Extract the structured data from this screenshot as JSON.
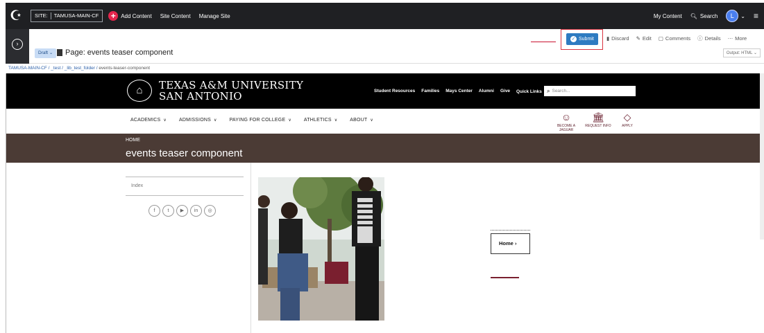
{
  "cms": {
    "site_label": "SITE:",
    "site_name": "TAMUSA-MAIN-CF",
    "add_content": "Add Content",
    "site_content": "Site Content",
    "manage_site": "Manage Site",
    "my_content": "My Content",
    "search": "Search",
    "user_initial": "L"
  },
  "toolbar": {
    "draft": "Draft",
    "page_title": "Page: events teaser component",
    "submit": "Submit",
    "discard": "Discard",
    "edit": "Edit",
    "comments": "Comments",
    "details": "Details",
    "more": "More",
    "output": "Output: HTML"
  },
  "breadcrumb": {
    "items": [
      "TAMUSA-MAIN-CF",
      "_test",
      "_lib_test_folder"
    ],
    "current": "events-teaser-component"
  },
  "site": {
    "uni_line1": "TEXAS A&M UNIVERSITY",
    "uni_line2": "SAN ANTONIO",
    "header_links": [
      "Student Resources",
      "Families",
      "Mays Center",
      "Alumni",
      "Give",
      "Quick Links"
    ],
    "search_placeholder": "Search...",
    "nav": [
      "ACADEMICS",
      "ADMISSIONS",
      "PAYING FOR COLLEGE",
      "ATHLETICS",
      "ABOUT"
    ],
    "cta": [
      "BECOME A JAGUAR",
      "REQUEST INFO",
      "APPLY"
    ],
    "crumb_home": "HOME",
    "page_heading": "events teaser component",
    "side_index": "Index",
    "card_label": "Home"
  },
  "colors": {
    "cms_bar": "#1f2023",
    "submit_blue": "#2e7bc1",
    "highlight_red": "#d9333f",
    "title_band": "#4b3b35",
    "maroon": "#7a1f2f"
  }
}
